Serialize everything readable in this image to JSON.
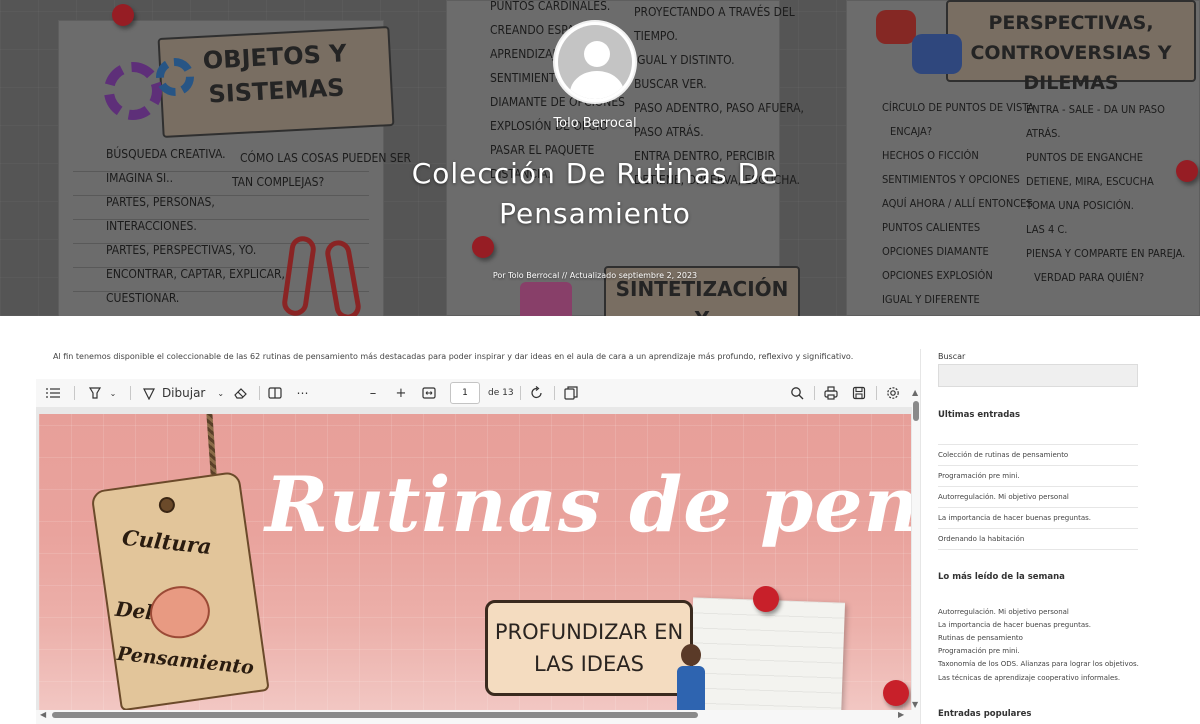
{
  "hero": {
    "author_name": "Tolo Berrocal",
    "title_line1": "Colección De Rutinas De",
    "title_line2": "Pensamiento",
    "meta": "Por Tolo Berrocal  //  Actualizado septiembre 2, 2023",
    "background": {
      "left_tag": [
        "OBJETOS Y",
        "SISTEMAS"
      ],
      "left_items": [
        "BÚSQUEDA CREATIVA.",
        "IMAGINA SI..",
        "PARTES, PERSONAS,",
        "INTERACCIONES.",
        "PARTES, PERSPECTIVAS, YO.",
        "ENCONTRAR, CAPTAR, EXPLICAR,",
        "CUESTIONAR."
      ],
      "left_items_b": [
        "CÓMO LAS COSAS PUEDEN SER",
        "TAN COMPLEJAS?"
      ],
      "mid_items_a": [
        "PUNTOS CARDINALES.",
        "CREANDO ESPACIOS",
        "APRENDIZAJE.",
        "SENTIMIENTOS Y",
        "DIAMANTE DE OPCIONES",
        "EXPLOSIÓN DE OPCIO",
        "PASAR EL PAQUETE",
        "DISTANCIA."
      ],
      "mid_items_b": [
        "PROYECTANDO A TRAVÉS DEL",
        "TIEMPO.",
        "IGUAL Y DISTINTO.",
        "BUSCAR VER.",
        "PASO ADENTRO, PASO AFUERA,",
        "PASO ATRÁS.",
        "ENTRA DENTRO, PERCIBIR",
        "DETIENE, OBSERVA, ESCUCHA."
      ],
      "mid_tag": "SINTETIZACIÓN Y",
      "right_tag": [
        "PERSPECTIVAS,",
        "CONTROVERSIAS Y DILEMAS"
      ],
      "right_items_a": [
        "CÍRCULO DE PUNTOS DE VISTA",
        "ENCAJA?",
        "HECHOS O FICCIÓN",
        "SENTIMIENTOS Y OPCIONES",
        "AQUÍ AHORA / ALLÍ ENTONCES",
        "PUNTOS CALIENTES",
        "OPCIONES DIAMANTE",
        "OPCIONES EXPLOSIÓN",
        "IGUAL Y DIFERENTE"
      ],
      "right_items_b": [
        "ENTRA - SALE - DA UN PASO",
        "ATRÁS.",
        "PUNTOS DE ENGANCHE",
        "DETIENE, MIRA, ESCUCHA",
        "TOMA UNA POSICIÓN.",
        "LAS 4 C.",
        "PIENSA Y COMPARTE EN PAREJA.",
        "VERDAD PARA QUIÉN?"
      ]
    }
  },
  "intro": "Al fin tenemos disponible el coleccionable de las 62 rutinas de pensamiento más destacadas para poder inspirar y dar ideas en el aula de cara a un aprendizaje más profundo, reflexivo y significativo.",
  "viewer": {
    "toolbar": {
      "contents_icon": "list-icon",
      "highlight_icon": "highlighter-icon",
      "draw_label": "Dibujar",
      "current_page": "1",
      "page_total": "de 13"
    },
    "page": {
      "headline": "Rutinas de pensam",
      "tag_words": [
        "Cultura",
        "Del",
        "Pensamiento"
      ],
      "ribbon_lines": [
        "PROFUNDIZAR EN",
        "LAS IDEAS"
      ]
    }
  },
  "sidebar": {
    "search_label": "Buscar",
    "search_value": "",
    "recent_heading": "Ultimas entradas",
    "recent": [
      "Colección de rutinas de pensamiento",
      "Programación pre mini.",
      "Autorregulación. Mi objetivo personal",
      "La importancia de hacer buenas preguntas.",
      "Ordenando la habitación"
    ],
    "most_read_heading": "Lo más leído de la semana",
    "most_read": [
      "Autorregulación. Mi objetivo personal",
      "La importancia de hacer buenas preguntas.",
      "Rutinas de pensamiento",
      "Programación pre mini.",
      "Taxonomía de los ODS. Alianzas para lograr los objetivos.",
      "Las técnicas de aprendizaje cooperativo informales."
    ],
    "popular_heading": "Entradas populares"
  },
  "colors": {
    "pdf_page": "#e9a39d",
    "accent_pin": "#c8202a"
  }
}
